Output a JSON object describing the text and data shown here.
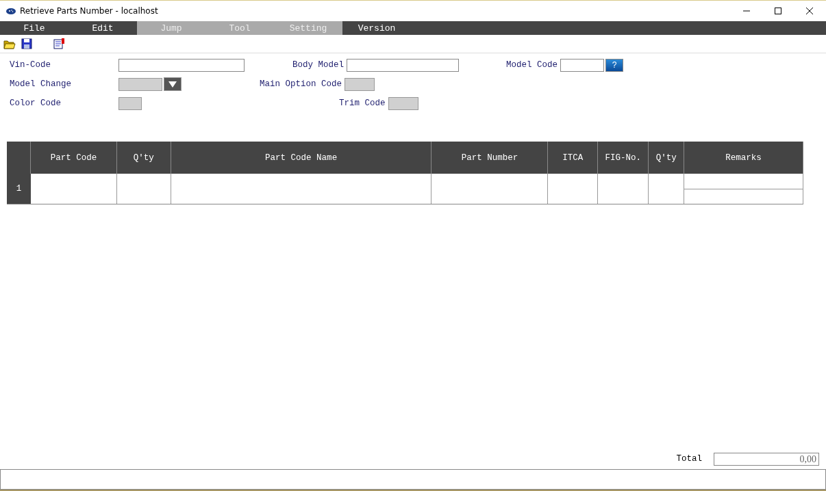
{
  "window": {
    "title": "Retrieve Parts Number - localhost"
  },
  "menu": [
    {
      "label": "File",
      "disabled": false
    },
    {
      "label": "Edit",
      "disabled": false
    },
    {
      "label": "Jump",
      "disabled": true
    },
    {
      "label": "Tool",
      "disabled": true
    },
    {
      "label": "Setting",
      "disabled": true
    },
    {
      "label": "Version",
      "disabled": false
    }
  ],
  "form_rows": [
    [
      {
        "label": "Vin-Code",
        "kind": "text",
        "disabled": false
      },
      {
        "label": "Body Model",
        "kind": "text",
        "disabled": false
      },
      {
        "label": "Model Code",
        "kind": "lookup",
        "disabled": false
      }
    ],
    [
      {
        "label": "Model Change",
        "kind": "select",
        "disabled": true
      },
      {
        "label": "Main Option Code",
        "kind": "text",
        "disabled": true
      }
    ],
    [
      {
        "label": "Color Code",
        "kind": "text",
        "disabled": true
      },
      {
        "label": "Trim Code",
        "kind": "text",
        "disabled": true
      }
    ]
  ],
  "lookup_button": {
    "label": "?"
  },
  "table": {
    "columns": [
      "Part Code",
      "Q'ty",
      "Part Code Name",
      "Part Number",
      "ITCA",
      "FIG-No.",
      "Q'ty",
      "Remarks"
    ],
    "rows": [
      {
        "number": "1"
      }
    ]
  },
  "total": {
    "label": "Total",
    "value": "0,00"
  }
}
